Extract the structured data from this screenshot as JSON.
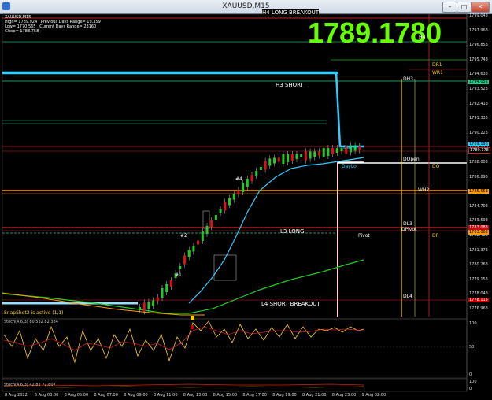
{
  "window": {
    "title": "XAUUSD,M15",
    "min": "–",
    "max": "□",
    "close": "✕"
  },
  "info": {
    "symbol": "XAUUSD,M15",
    "line2": "High= 1789.924   Previous Days Range= 19.359",
    "line3": "Low= 1770.565   Current Days Range= 28160",
    "line4": "Close= 1788.758"
  },
  "big_price": "1789.1780",
  "levels": {
    "h4_long": "H4 LONG BREAKOUT",
    "h3_short": "H3 SHORT",
    "l3_long": "L3 LONG",
    "l4_short": "L4 SHORT BREAKOUT",
    "h4": "H4",
    "dh3": "DH3",
    "dopen": "DOpen",
    "do": "DO",
    "wh2": "WH2",
    "dl3": "DL3",
    "dpivot": "DPivot",
    "dp": "DP",
    "pivot": "Pivot",
    "dl4": "DL4",
    "dayhi": "DayHi",
    "daylo": "DayLo",
    "dr1": "DR1",
    "wr1": "WR1"
  },
  "marks": {
    "m1": "#1",
    "m2": "#2",
    "m4": "#4"
  },
  "price_axis": [
    "1799.043",
    "1797.963",
    "1796.853",
    "1795.743",
    "1794.633",
    "1793.523",
    "1792.413",
    "1791.333",
    "1790.223",
    "1789.113",
    "1788.003",
    "1786.893",
    "1785.783",
    "1784.703",
    "1783.593",
    "1782.483",
    "1781.373",
    "1780.263",
    "1779.153",
    "1778.043",
    "1776.963"
  ],
  "axis_tags": {
    "t1": "1794.052",
    "t2": "1789.196",
    "t3": "1789.178",
    "t4": "1785.553",
    "t5": "1783.083",
    "t6": "1783.062",
    "t7": "1778.115"
  },
  "time_axis": [
    "8 Aug 2022",
    "8 Aug 03:00",
    "8 Aug 05:00",
    "8 Aug 07:00",
    "8 Aug 09:00",
    "8 Aug 11:00",
    "8 Aug 13:00",
    "8 Aug 15:00",
    "8 Aug 17:00",
    "8 Aug 19:00",
    "8 Aug 21:00",
    "8 Aug 23:00",
    "9 Aug 02:00"
  ],
  "snapshot_text": "SnapShot2 is active (1,1)",
  "stoch1_label": "Stoch(4,6,3) 80.532 82.384",
  "stoch1_axis": [
    "100",
    "50",
    "0"
  ],
  "stoch2_label": "Stoch(4,6,3) 42.82 72.807",
  "stoch2_axis": [
    "100",
    "0"
  ],
  "colors": {
    "price": "#66ff00",
    "cyan": "#33ccff",
    "orange": "#ff9900",
    "red": "#cc0000",
    "yellow": "#ffd400",
    "green": "#22cc22",
    "white": "#ffffff"
  }
}
